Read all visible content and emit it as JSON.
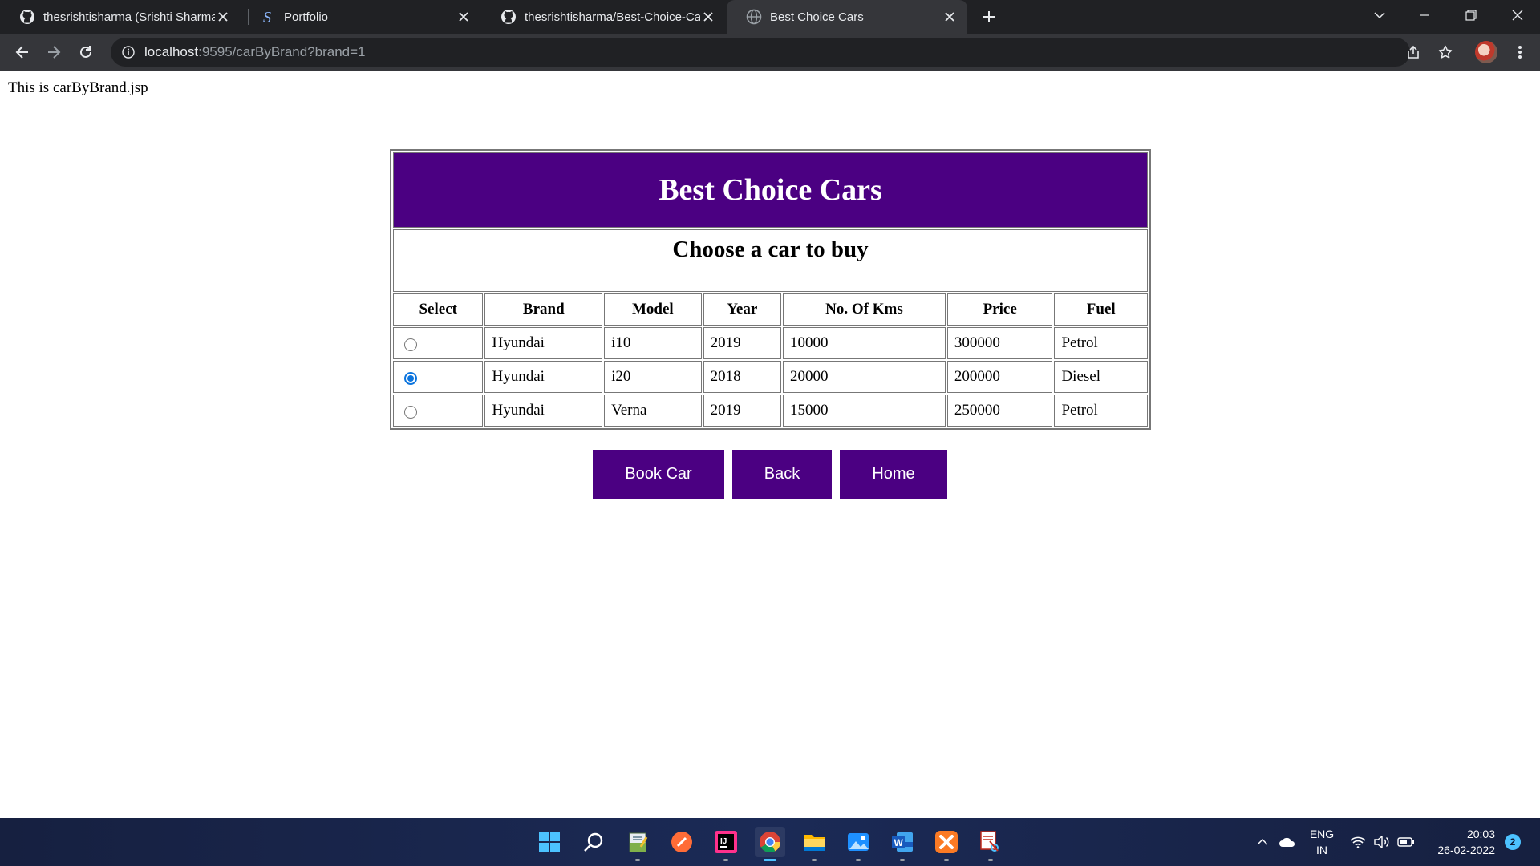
{
  "browser": {
    "tabs": [
      {
        "title": "thesrishtisharma (Srishti Sharma)",
        "favicon": "github-icon",
        "active": false
      },
      {
        "title": "Portfolio",
        "favicon": "portfolio-s-icon",
        "active": false
      },
      {
        "title": "thesrishtisharma/Best-Choice-Cars",
        "favicon": "github-icon",
        "active": false
      },
      {
        "title": "Best Choice Cars",
        "favicon": "globe-icon",
        "active": true
      }
    ],
    "url_host": "localhost",
    "url_rest": ":9595/carByBrand?brand=1"
  },
  "page": {
    "note": "This is carByBrand.jsp",
    "title": "Best Choice Cars",
    "subtitle": "Choose a car to buy",
    "accent_color": "#4b0082",
    "columns": [
      "Select",
      "Brand",
      "Model",
      "Year",
      "No. Of Kms",
      "Price",
      "Fuel"
    ],
    "rows": [
      {
        "selected": false,
        "brand": "Hyundai",
        "model": "i10",
        "year": "2019",
        "kms": "10000",
        "price": "300000",
        "fuel": "Petrol"
      },
      {
        "selected": true,
        "brand": "Hyundai",
        "model": "i20",
        "year": "2018",
        "kms": "20000",
        "price": "200000",
        "fuel": "Diesel"
      },
      {
        "selected": false,
        "brand": "Hyundai",
        "model": "Verna",
        "year": "2019",
        "kms": "15000",
        "price": "250000",
        "fuel": "Petrol"
      }
    ],
    "buttons": {
      "book": "Book Car",
      "back": "Back",
      "home": "Home"
    }
  },
  "taskbar": {
    "apps": [
      "windows-start-icon",
      "search-icon",
      "notepad-icon",
      "postman-icon",
      "intellij-icon",
      "chrome-icon",
      "file-explorer-icon",
      "photos-icon",
      "word-icon",
      "xampp-icon",
      "snipping-tool-icon"
    ],
    "lang_1": "ENG",
    "lang_2": "IN",
    "time": "20:03",
    "date": "26-02-2022",
    "notifications": "2"
  }
}
